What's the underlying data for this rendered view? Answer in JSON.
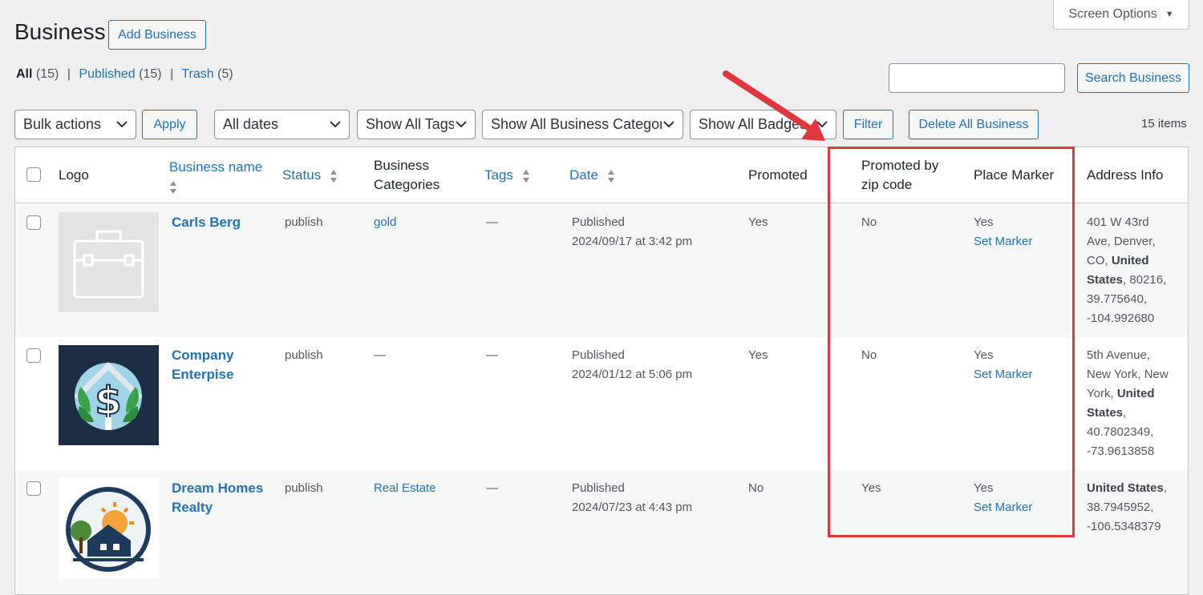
{
  "screen_options": {
    "label": "Screen Options"
  },
  "page": {
    "title": "Business",
    "add_button": "Add Business"
  },
  "views": {
    "all": {
      "label": "All",
      "count": "(15)"
    },
    "published": {
      "label": "Published",
      "count": "(15)"
    },
    "trash": {
      "label": "Trash",
      "count": "(5)"
    },
    "separator": "|"
  },
  "search": {
    "value": "",
    "button": "Search Business"
  },
  "filters": {
    "bulk_actions": "Bulk actions",
    "apply": "Apply",
    "dates": "All dates",
    "tags": "Show All Tags",
    "categories": "Show All Business Categori",
    "badges": "Show All Badges",
    "filter": "Filter",
    "delete_all": "Delete All Business"
  },
  "items_count": "15 items",
  "columns": {
    "logo": "Logo",
    "business_name": "Business name",
    "status": "Status",
    "categories_line1": "Business",
    "categories_line2": "Categories",
    "tags": "Tags",
    "date": "Date",
    "promoted": "Promoted",
    "promoted_zip_line1": "Promoted by",
    "promoted_zip_line2": "zip code",
    "place_marker": "Place Marker",
    "address": "Address Info"
  },
  "rows": [
    {
      "name_line1": "Carls Berg",
      "name_line2": "",
      "status": "publish",
      "category": "gold",
      "tags": "—",
      "date_status": "Published",
      "date": "2024/09/17 at 3:42 pm",
      "promoted": "Yes",
      "promoted_zip": "No",
      "marker": "Yes",
      "marker_link": "Set Marker",
      "addr": {
        "l1": "401 W 43rd",
        "l2": "Ave, Denver,",
        "l3a": "CO, ",
        "l3b": "United",
        "l4a": "States",
        "l4b": ", 80216,",
        "l5": "39.775640,",
        "l6": "-104.992680"
      }
    },
    {
      "name_line1": "Company",
      "name_line2": "Enterpise",
      "status": "publish",
      "category": "—",
      "tags": "—",
      "date_status": "Published",
      "date": "2024/01/12 at 5:06 pm",
      "promoted": "Yes",
      "promoted_zip": "No",
      "marker": "Yes",
      "marker_link": "Set Marker",
      "addr": {
        "l1": "5th Avenue,",
        "l2": "New York, New",
        "l3a": "York, ",
        "l3b": "United",
        "l4a": "States",
        "l4b": ",",
        "l5": "40.7802349,",
        "l6": "-73.9613858"
      }
    },
    {
      "name_line1": "Dream Homes",
      "name_line2": "Realty",
      "status": "publish",
      "category": "Real Estate",
      "tags": "—",
      "date_status": "Published",
      "date": "2024/07/23 at 4:43 pm",
      "promoted": "No",
      "promoted_zip": "Yes",
      "marker": "Yes",
      "marker_link": "Set Marker",
      "addr": {
        "l1a": "United States",
        "l1b": ",",
        "l2": "38.7945952,",
        "l3": "-106.5348379"
      }
    }
  ],
  "icons": {
    "caret": "caret-down-icon",
    "chevron": "chevron-down-icon",
    "sort": "sort-arrows-icon",
    "placeholder_logo": "briefcase-icon"
  },
  "colors": {
    "accent": "#2271b1",
    "highlight": "#e0363e",
    "background": "#f0f0f1"
  }
}
